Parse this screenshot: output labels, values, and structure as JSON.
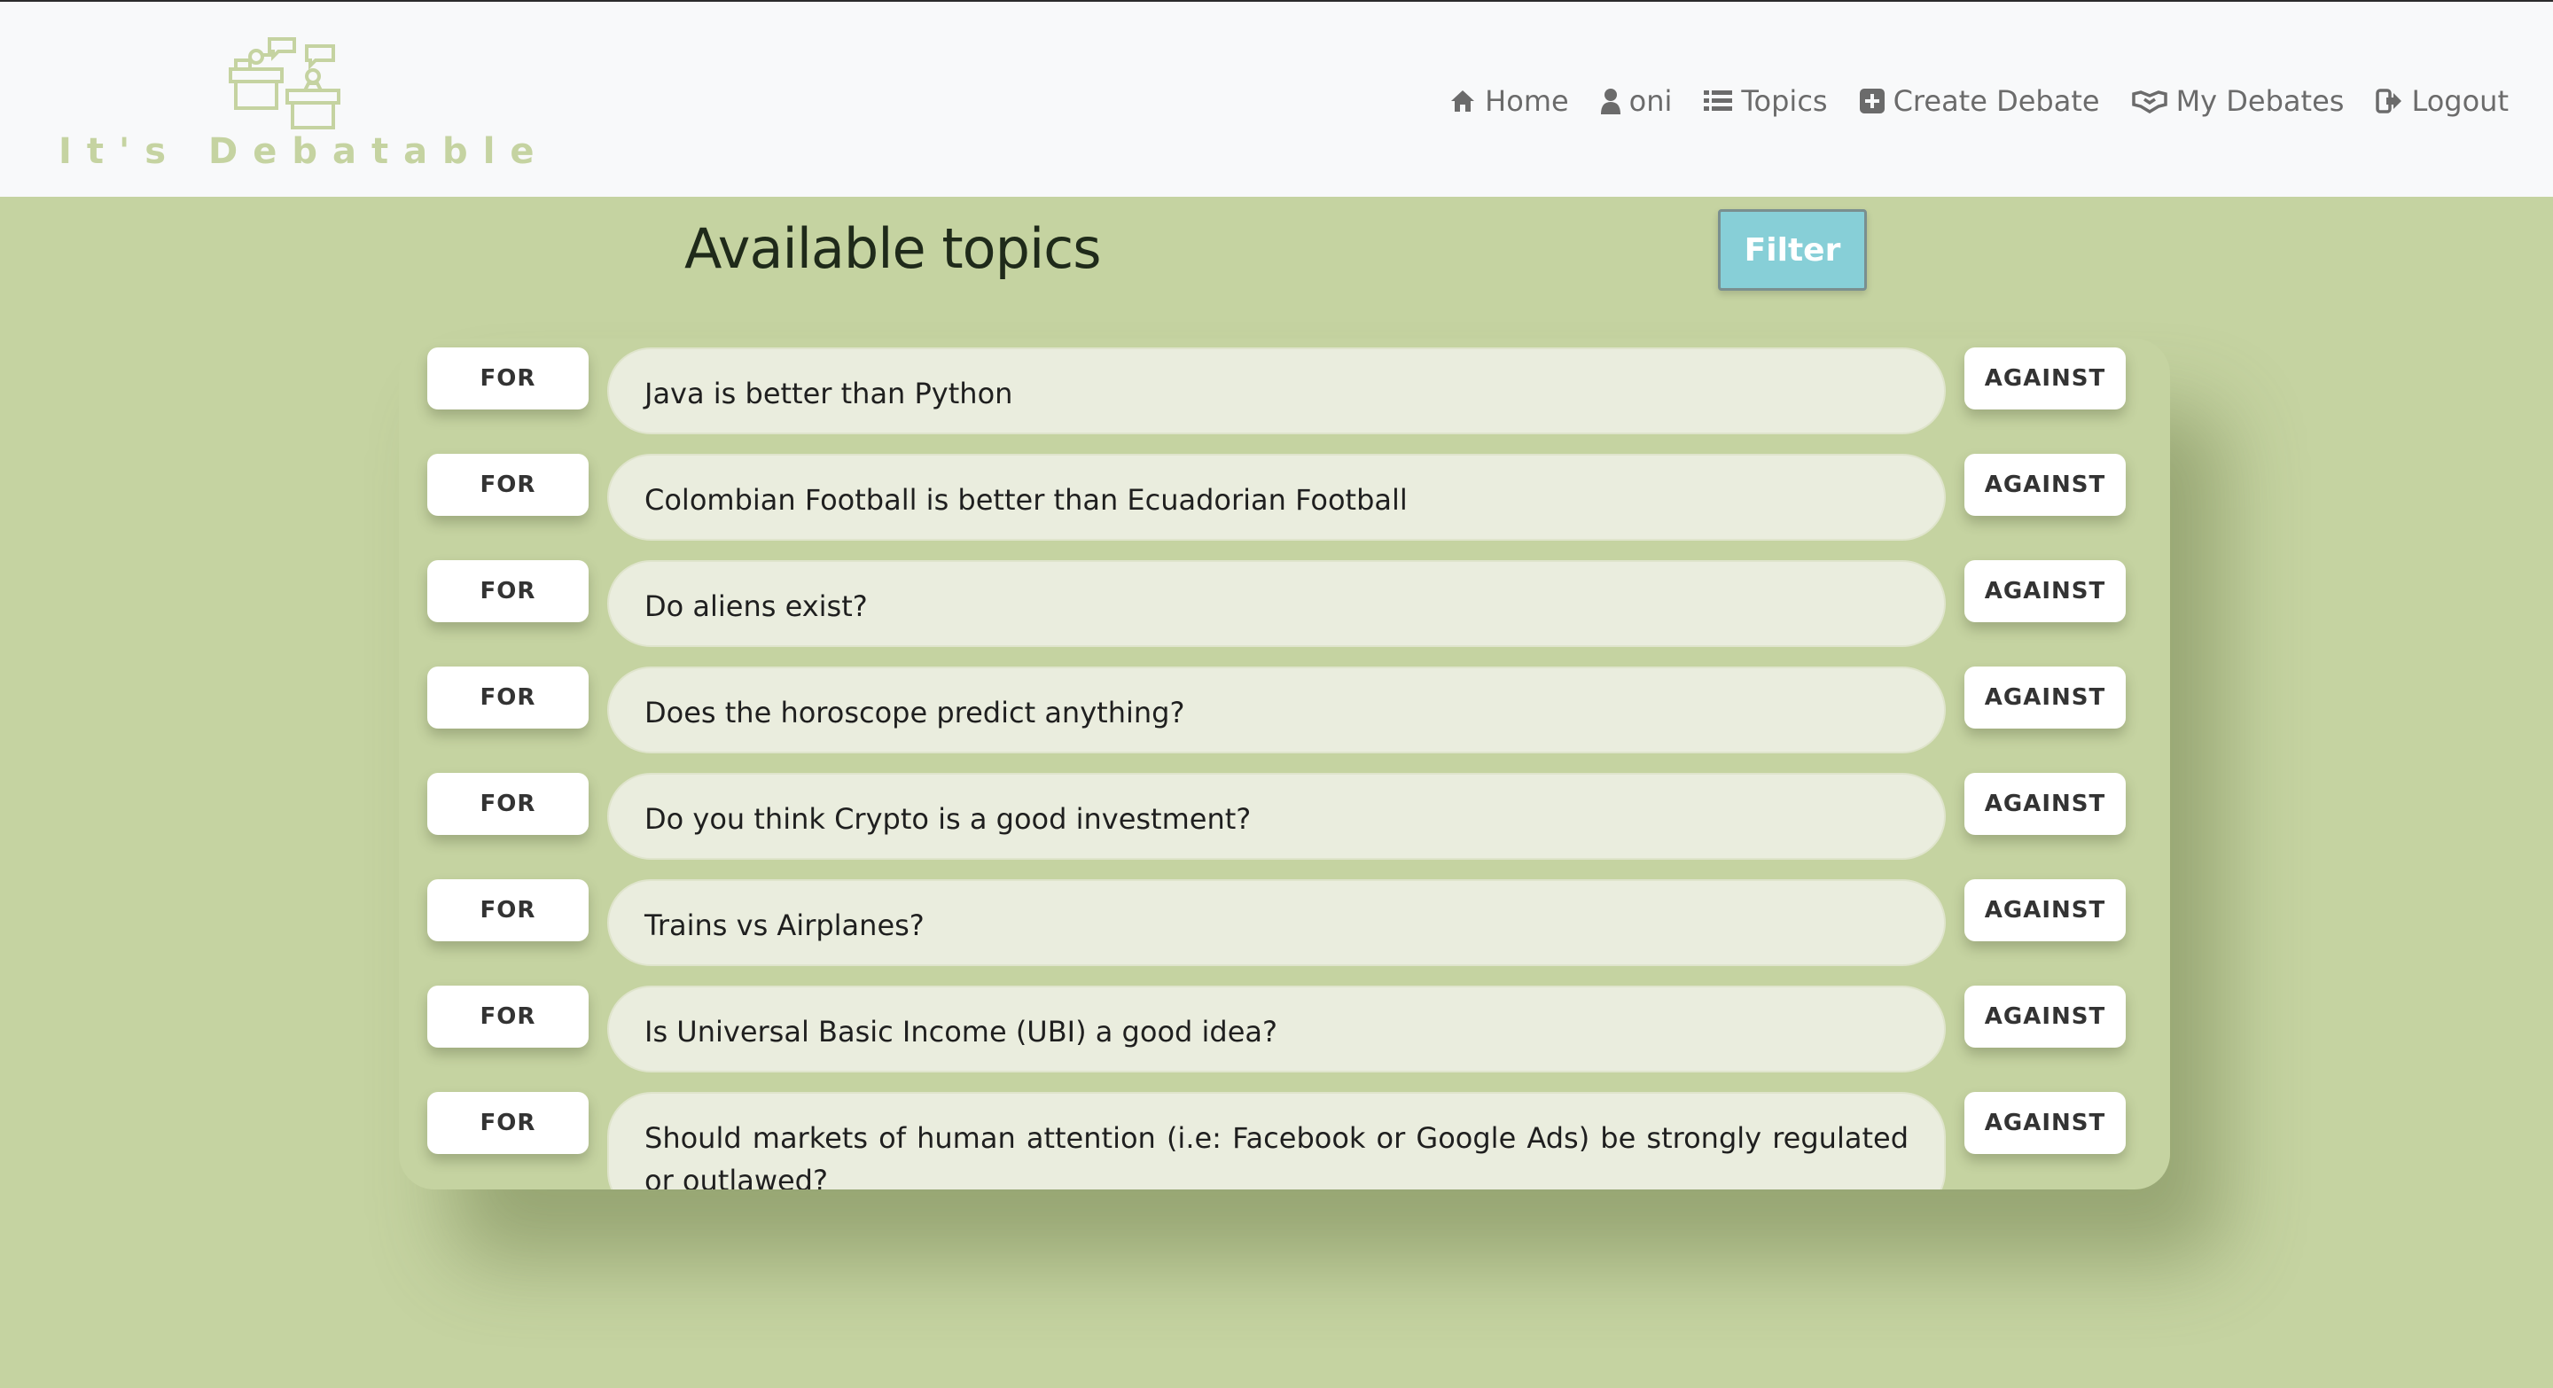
{
  "brand": {
    "name": "It's Debatable",
    "color": "#c5d3a1"
  },
  "nav": [
    {
      "icon": "home-icon",
      "label": "Home"
    },
    {
      "icon": "user-icon",
      "label": "oni"
    },
    {
      "icon": "list-icon",
      "label": "Topics"
    },
    {
      "icon": "plus-square-icon",
      "label": "Create Debate"
    },
    {
      "icon": "handshake-icon",
      "label": "My Debates"
    },
    {
      "icon": "sign-out-icon",
      "label": "Logout"
    }
  ],
  "main": {
    "title": "Available topics",
    "filter_label": "Filter",
    "for_label": "FOR",
    "against_label": "AGAINST",
    "topics": [
      "Java is better than Python",
      "Colombian Football is better than Ecuadorian Football",
      "Do aliens exist?",
      "Does the horoscope predict anything?",
      "Do you think Crypto is a good investment?",
      "Trains vs Airplanes?",
      "Is Universal Basic Income (UBI) a good idea?",
      "Should markets of human attention (i.e: Facebook or Google Ads) be strongly regulated or outlawed?"
    ]
  },
  "colors": {
    "background": "#c5d3a1",
    "header": "#f8f9fa",
    "topic_pill": "#eaedde",
    "filter_button": "#87cfd7"
  }
}
